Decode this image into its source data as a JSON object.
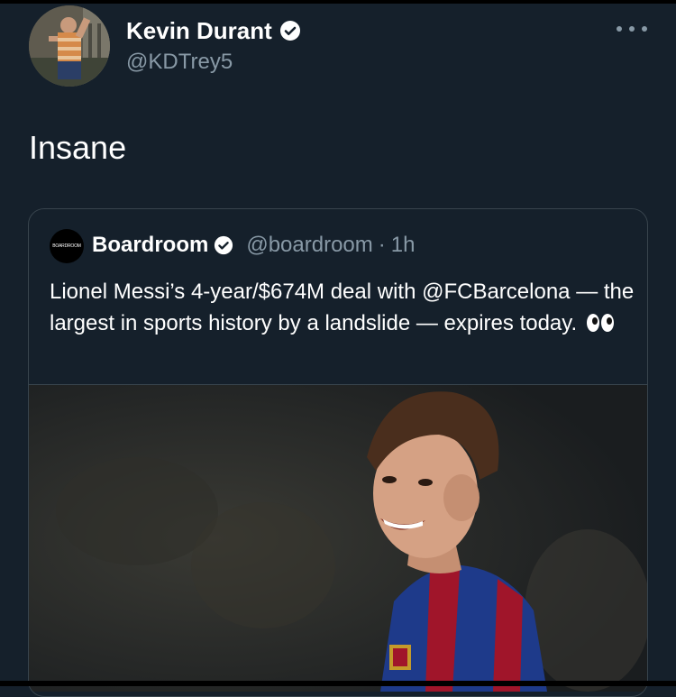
{
  "tweet": {
    "author_name": "Kevin Durant",
    "handle": "@KDTrey5",
    "text": "Insane",
    "menu_icon": "more-horizontal-icon",
    "verified_icon": "verified-badge-icon"
  },
  "quoted": {
    "avatar_text": "BOARDROOM",
    "name": "Boardroom",
    "handle": "@boardroom",
    "separator": "·",
    "time": "1h",
    "text": "Lionel Messi’s 4-year/$674M deal with @FCBarcelona — the largest in sports history by a landslide — expires today.",
    "emoji_icon": "eyes-emoji-icon",
    "media_icon": "photo-icon"
  },
  "colors": {
    "background": "#15202b",
    "secondary_text": "#8899a6",
    "border": "#38444d",
    "jersey_blue": "#1e3a8a",
    "jersey_red": "#a0152a"
  }
}
